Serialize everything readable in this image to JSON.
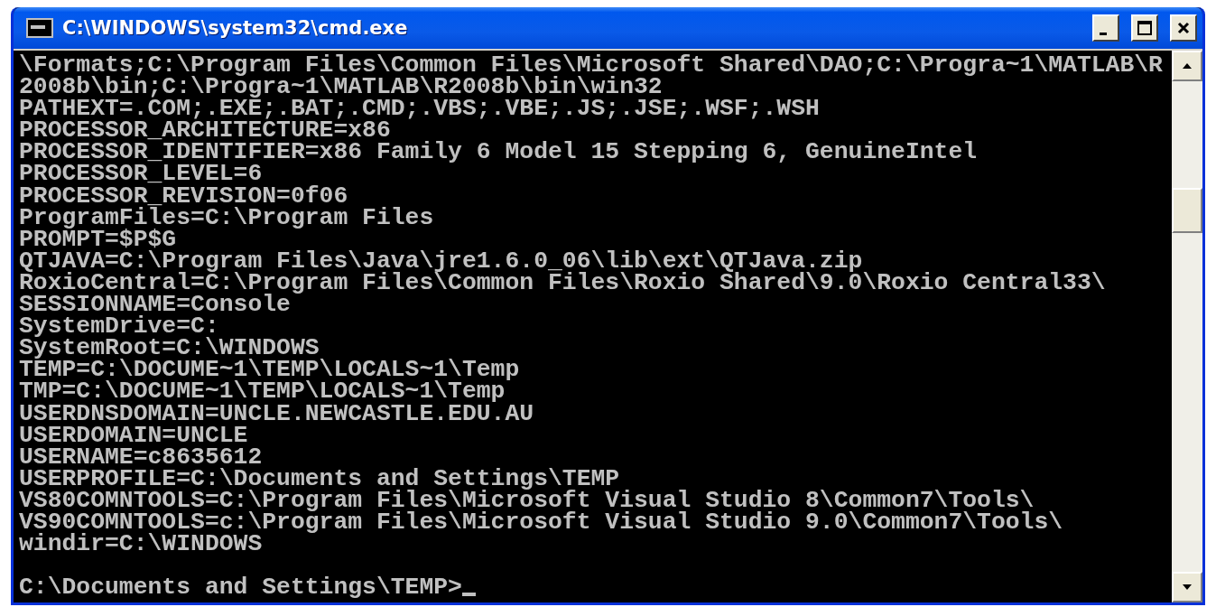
{
  "window": {
    "title": "C:\\WINDOWS\\system32\\cmd.exe"
  },
  "console": {
    "lines": [
      "\\Formats;C:\\Program Files\\Common Files\\Microsoft Shared\\DAO;C:\\Progra~1\\MATLAB\\R",
      "2008b\\bin;C:\\Progra~1\\MATLAB\\R2008b\\bin\\win32",
      "PATHEXT=.COM;.EXE;.BAT;.CMD;.VBS;.VBE;.JS;.JSE;.WSF;.WSH",
      "PROCESSOR_ARCHITECTURE=x86",
      "PROCESSOR_IDENTIFIER=x86 Family 6 Model 15 Stepping 6, GenuineIntel",
      "PROCESSOR_LEVEL=6",
      "PROCESSOR_REVISION=0f06",
      "ProgramFiles=C:\\Program Files",
      "PROMPT=$P$G",
      "QTJAVA=C:\\Program Files\\Java\\jre1.6.0_06\\lib\\ext\\QTJava.zip",
      "RoxioCentral=C:\\Program Files\\Common Files\\Roxio Shared\\9.0\\Roxio Central33\\",
      "SESSIONNAME=Console",
      "SystemDrive=C:",
      "SystemRoot=C:\\WINDOWS",
      "TEMP=C:\\DOCUME~1\\TEMP\\LOCALS~1\\Temp",
      "TMP=C:\\DOCUME~1\\TEMP\\LOCALS~1\\Temp",
      "USERDNSDOMAIN=UNCLE.NEWCASTLE.EDU.AU",
      "USERDOMAIN=UNCLE",
      "USERNAME=c8635612",
      "USERPROFILE=C:\\Documents and Settings\\TEMP",
      "VS80COMNTOOLS=C:\\Program Files\\Microsoft Visual Studio 8\\Common7\\Tools\\",
      "VS90COMNTOOLS=c:\\Program Files\\Microsoft Visual Studio 9.0\\Common7\\Tools\\",
      "windir=C:\\WINDOWS"
    ],
    "prompt": "C:\\Documents and Settings\\TEMP>"
  }
}
